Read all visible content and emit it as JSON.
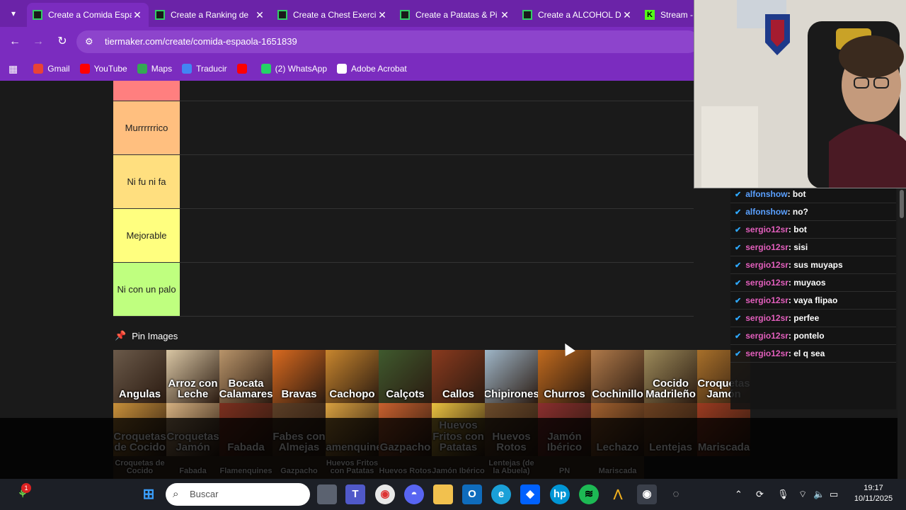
{
  "tabs": [
    {
      "title": "Create a Comida Espa",
      "active": true,
      "favicon": "tiermaker-icon"
    },
    {
      "title": "Create a Ranking de",
      "active": false,
      "favicon": "tiermaker-icon"
    },
    {
      "title": "Create a Chest Exerci",
      "active": false,
      "favicon": "tiermaker-icon"
    },
    {
      "title": "Create a Patatas & Pi",
      "active": false,
      "favicon": "tiermaker-icon"
    },
    {
      "title": "Create a ALCOHOL D",
      "active": false,
      "favicon": "tiermaker-icon"
    },
    {
      "title": "Stream - I",
      "active": false,
      "favicon": "kick-icon"
    }
  ],
  "tab_close": "✕",
  "address": {
    "url": "tiermaker.com/create/comida-espaola-1651839"
  },
  "bookmarks": [
    {
      "label": "Gmail",
      "icon": "gmail-icon",
      "color": "#ea4335"
    },
    {
      "label": "YouTube",
      "icon": "youtube-icon",
      "color": "#ff0000"
    },
    {
      "label": "Maps",
      "icon": "maps-icon",
      "color": "#34a853"
    },
    {
      "label": "Traducir",
      "icon": "translate-icon",
      "color": "#4285f4"
    },
    {
      "label": "",
      "icon": "youtube-icon",
      "color": "#ff0000"
    },
    {
      "label": "(2) WhatsApp",
      "icon": "whatsapp-icon",
      "color": "#25d366"
    },
    {
      "label": "Adobe Acrobat",
      "icon": "acrobat-icon",
      "color": "#ffffff"
    }
  ],
  "tiers": [
    {
      "label": "",
      "color": "#ff7f7f",
      "height": 29
    },
    {
      "label": "Murrrrrrico",
      "color": "#ffbf7f",
      "height": 76
    },
    {
      "label": "Ni fu ni fa",
      "color": "#ffdf7f",
      "height": 76
    },
    {
      "label": "Mejorable",
      "color": "#ffff7f",
      "height": 76
    },
    {
      "label": "Ni con un palo",
      "color": "#bfff7f",
      "height": 76
    }
  ],
  "pin_images_label": "Pin Images",
  "food_images": [
    {
      "label": "Angulas",
      "color": "#6b5a4a"
    },
    {
      "label": "Arroz con Leche",
      "color": "#d9c6a4"
    },
    {
      "label": "Bocata Calamares",
      "color": "#b8946a"
    },
    {
      "label": "Bravas",
      "color": "#d96a1f"
    },
    {
      "label": "Cachopo",
      "color": "#c8862e"
    },
    {
      "label": "Calçots",
      "color": "#3f5a2e"
    },
    {
      "label": "Callos",
      "color": "#8a3a1e"
    },
    {
      "label": "Chipirones",
      "color": "#9fb6c8"
    },
    {
      "label": "Churros",
      "color": "#c06a1e"
    },
    {
      "label": "Cochinillo",
      "color": "#b07a4a"
    },
    {
      "label": "Cocido Madrileño",
      "color": "#9c8a5a"
    },
    {
      "label": "Croquetas Jamón",
      "color": "#a8702a"
    },
    {
      "label": "Croquetas de Cocido",
      "color": "#c8903a"
    },
    {
      "label": "Croquetas Jamón",
      "color": "#d4b080"
    },
    {
      "label": "Fabada",
      "color": "#7a2e1e"
    },
    {
      "label": "Fabes con Almejas",
      "color": "#5a3e26"
    },
    {
      "label": "Flamenquines",
      "color": "#d8a040"
    },
    {
      "label": "Gazpacho",
      "color": "#c8602e"
    },
    {
      "label": "Huevos Fritos con Patatas",
      "color": "#e8c040"
    },
    {
      "label": "Huevos Rotos",
      "color": "#6a4a2a"
    },
    {
      "label": "Jamón Ibérico",
      "color": "#8a2e2e"
    },
    {
      "label": "Lechazo",
      "color": "#a0602e"
    },
    {
      "label": "Lentejas",
      "color": "#6a4020"
    },
    {
      "label": "Mariscada",
      "color": "#9a3a20"
    }
  ],
  "dimmed_labels": [
    "Croquetas de Cocido",
    "Fabada",
    "Flamenquines",
    "Gazpacho",
    "Huevos Fritos con Patatas",
    "Huevos Rotos",
    "Jamón Ibérico",
    "Lentejas (de la Abuela)",
    "PN",
    "Mariscada"
  ],
  "chat": [
    {
      "user": "alfonshow",
      "msg": ": bot",
      "color": "blue"
    },
    {
      "user": "alfonshow",
      "msg": ": no?",
      "color": "blue"
    },
    {
      "user": "sergio12sr",
      "msg": ": bot",
      "color": "pink"
    },
    {
      "user": "sergio12sr",
      "msg": ": sisi",
      "color": "pink"
    },
    {
      "user": "sergio12sr",
      "msg": ": sus muyaps",
      "color": "pink"
    },
    {
      "user": "sergio12sr",
      "msg": ": muyaos",
      "color": "pink"
    },
    {
      "user": "sergio12sr",
      "msg": ": vaya flipao",
      "color": "pink"
    },
    {
      "user": "sergio12sr",
      "msg": ": perfee",
      "color": "pink"
    },
    {
      "user": "sergio12sr",
      "msg": ": pontelo",
      "color": "pink"
    },
    {
      "user": "sergio12sr",
      "msg": ": el q sea",
      "color": "pink"
    }
  ],
  "taskbar": {
    "search_placeholder": "Buscar",
    "notification_count": "1",
    "time": "19:17",
    "date": "10/11/2025"
  }
}
